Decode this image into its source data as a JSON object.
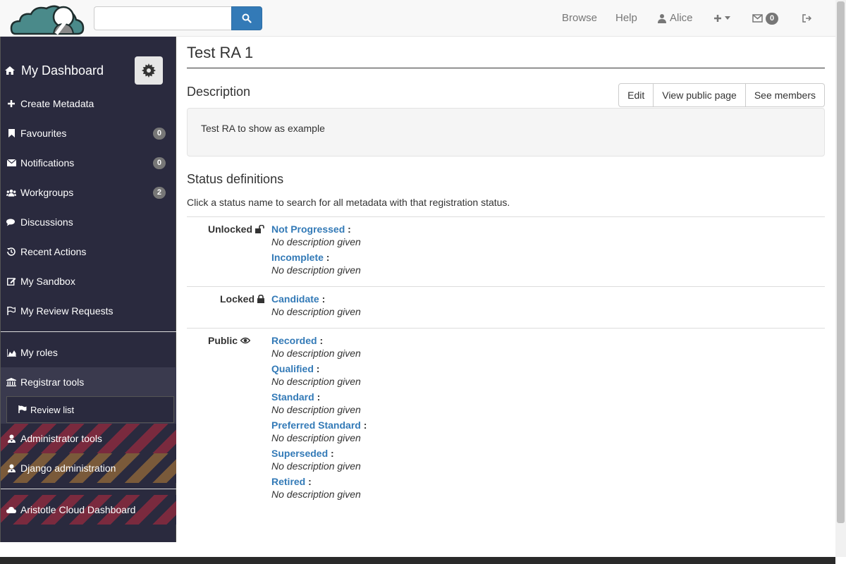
{
  "navbar": {
    "search_placeholder": "",
    "browse": "Browse",
    "help": "Help",
    "user": "Alice",
    "inbox_count": "0"
  },
  "sidebar": {
    "dashboard": "My Dashboard",
    "items": [
      {
        "label": "Create Metadata",
        "icon": "plus-icon"
      },
      {
        "label": "Favourites",
        "icon": "bookmark-icon",
        "badge": "0"
      },
      {
        "label": "Notifications",
        "icon": "envelope-icon",
        "badge": "0"
      },
      {
        "label": "Workgroups",
        "icon": "users-icon",
        "badge": "2"
      },
      {
        "label": "Discussions",
        "icon": "comments-icon"
      },
      {
        "label": "Recent Actions",
        "icon": "history-icon"
      },
      {
        "label": "My Sandbox",
        "icon": "edit-icon"
      },
      {
        "label": "My Review Requests",
        "icon": "flag-icon"
      }
    ],
    "my_roles": "My roles",
    "registrar_tools": "Registrar tools",
    "review_list": "Review list",
    "administrator_tools": "Administrator tools",
    "django_administration": "Django administration",
    "cloud_dashboard": "Aristotle Cloud Dashboard"
  },
  "main": {
    "title": "Test RA 1",
    "description_heading": "Description",
    "buttons": {
      "edit": "Edit",
      "view_public": "View public page",
      "see_members": "See members"
    },
    "description_text": "Test RA to show as example",
    "status_heading": "Status definitions",
    "status_help": "Click a status name to search for all metadata with that registration status.",
    "states": [
      {
        "label": "Unlocked",
        "icon": "unlock-icon",
        "statuses": [
          {
            "name": "Not Progressed",
            "desc": "No description given"
          },
          {
            "name": "Incomplete",
            "desc": "No description given"
          }
        ]
      },
      {
        "label": "Locked",
        "icon": "lock-icon",
        "statuses": [
          {
            "name": "Candidate",
            "desc": "No description given"
          }
        ]
      },
      {
        "label": "Public",
        "icon": "eye-icon",
        "statuses": [
          {
            "name": "Recorded",
            "desc": "No description given"
          },
          {
            "name": "Qualified",
            "desc": "No description given"
          },
          {
            "name": "Standard",
            "desc": "No description given"
          },
          {
            "name": "Preferred Standard",
            "desc": "No description given"
          },
          {
            "name": "Superseded",
            "desc": "No description given"
          },
          {
            "name": "Retired",
            "desc": "No description given"
          }
        ]
      }
    ]
  },
  "colors": {
    "link": "#337ab7",
    "sidebar_bg": "#2a2a3e",
    "primary": "#337ab7"
  }
}
